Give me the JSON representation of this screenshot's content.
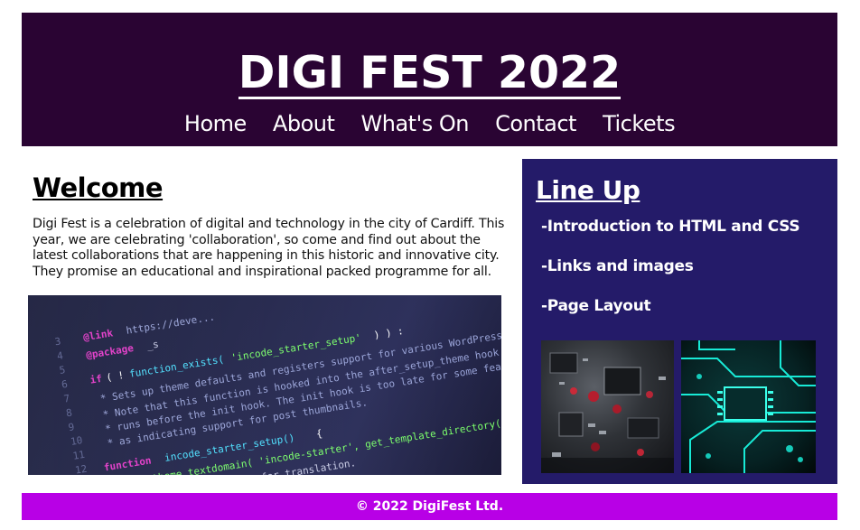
{
  "header": {
    "title": "DIGI FEST 2022",
    "nav": [
      "Home",
      "About",
      "What's On",
      "Contact",
      "Tickets"
    ]
  },
  "welcome": {
    "title": "Welcome",
    "paragraph": "Digi Fest is a celebration of digital and technology in the city of Cardiff. This year, we are celebrating 'collaboration', so come and find out about the latest collaborations that are happening in this historic and innovative city.",
    "paragraph2": "They promise an educational and inspirational packed programme for all."
  },
  "lineup": {
    "title": "Line Up",
    "items": [
      "-Introduction to HTML and CSS",
      "-Links and images",
      "-Page Layout"
    ]
  },
  "footer": {
    "text": "© 2022 DigiFest Ltd."
  },
  "colors": {
    "header_bg": "#2a0433",
    "lineup_bg": "#241b69",
    "footer_bg": "#b800e6"
  }
}
